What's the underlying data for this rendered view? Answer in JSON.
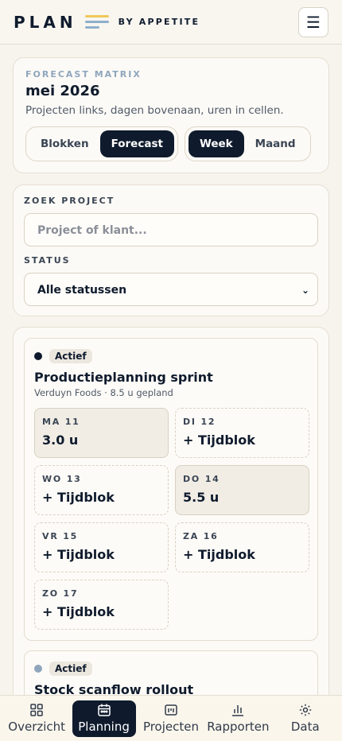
{
  "header": {
    "logo_word": "PLAN",
    "logo_by": "BY APPETITE",
    "menu_icon": "☰"
  },
  "forecast": {
    "eyebrow": "FORECAST MATRIX",
    "title": "mei 2026",
    "subtitle": "Projecten links, dagen bovenaan, uren in cellen.",
    "view_toggle": [
      {
        "label": "Blokken",
        "active": false
      },
      {
        "label": "Forecast",
        "active": true
      }
    ],
    "range_toggle": [
      {
        "label": "Week",
        "active": true
      },
      {
        "label": "Maand",
        "active": false
      }
    ]
  },
  "filters": {
    "search_label": "ZOEK PROJECT",
    "search_placeholder": "Project of klant...",
    "status_label": "STATUS",
    "status_value": "Alle statussen"
  },
  "projects": [
    {
      "status": "Actief",
      "dot_color": "#0f1b2d",
      "title": "Productieplanning sprint",
      "meta": "Verduyn Foods · 8.5 u gepland",
      "days": [
        {
          "label": "MA 11",
          "value": "3.0 u",
          "filled": true
        },
        {
          "label": "DI 12",
          "value": "+ Tijdblok",
          "filled": false
        },
        {
          "label": "WO 13",
          "value": "+ Tijdblok",
          "filled": false
        },
        {
          "label": "DO 14",
          "value": "5.5 u",
          "filled": true
        },
        {
          "label": "VR 15",
          "value": "+ Tijdblok",
          "filled": false
        },
        {
          "label": "ZA 16",
          "value": "+ Tijdblok",
          "filled": false
        },
        {
          "label": "ZO 17",
          "value": "+ Tijdblok",
          "filled": false
        }
      ]
    },
    {
      "status": "Actief",
      "dot_color": "#8fa6bd",
      "title": "Stock scanflow rollout",
      "meta": "",
      "days": []
    }
  ],
  "nav": [
    {
      "label": "Overzicht",
      "icon": "grid-icon",
      "active": false
    },
    {
      "label": "Planning",
      "icon": "calendar-icon",
      "active": true
    },
    {
      "label": "Projecten",
      "icon": "folder-icon",
      "active": false
    },
    {
      "label": "Rapporten",
      "icon": "bar-chart-icon",
      "active": false
    },
    {
      "label": "Data",
      "icon": "gear-icon",
      "active": false
    }
  ],
  "colors": {
    "primary": "#0f1b2d",
    "background": "#f7f4ee",
    "accent_yellow": "#f0c85a",
    "accent_blue": "#8fb0cc"
  }
}
